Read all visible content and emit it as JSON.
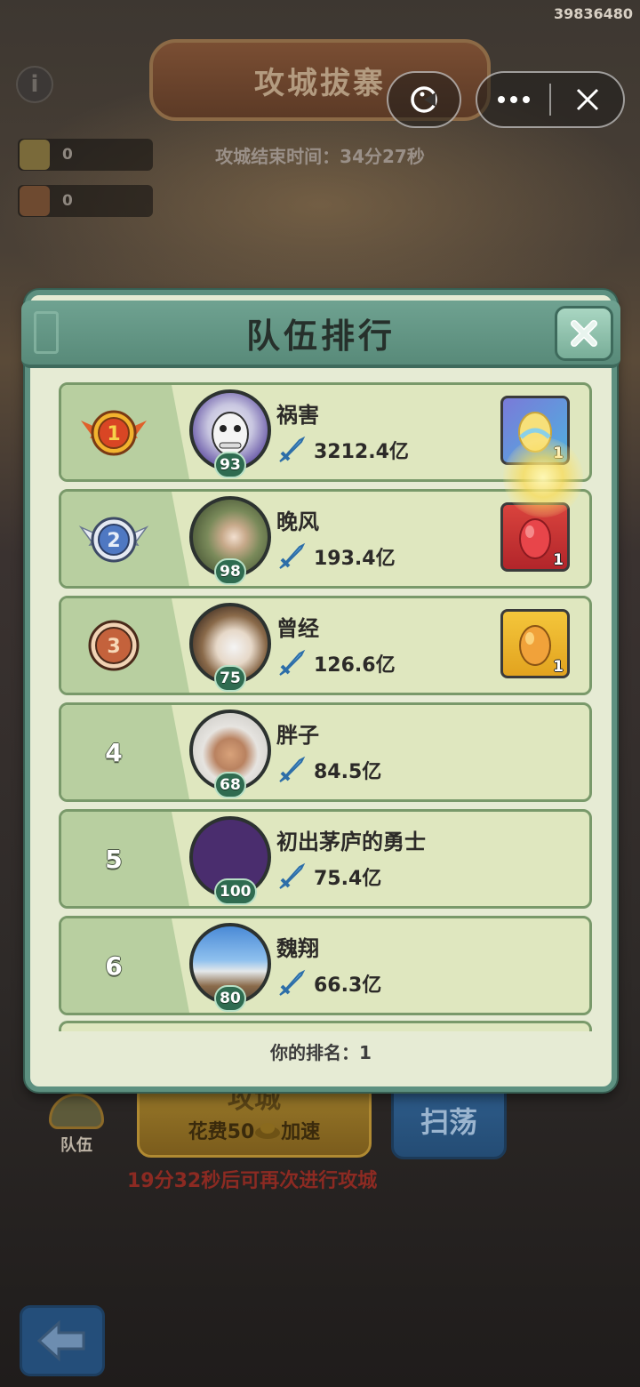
{
  "user_id": "39836480",
  "background": {
    "title": "攻城拔寨",
    "end_time": "攻城结束时间：34分27秒",
    "resources": [
      {
        "icon": "shield-resource-icon",
        "value": "0"
      },
      {
        "icon": "scroll-resource-icon",
        "value": "0"
      }
    ],
    "team_label": "队伍",
    "attack_label": "攻城",
    "attack_cost": "花费50",
    "attack_speed": "加速",
    "sweep_label": "扫荡",
    "cooldown_text": "19分32秒后可再次进行攻城"
  },
  "capsule": {
    "game_icon": "game-icon",
    "more_icon": "more-icon",
    "close_icon": "close-icon"
  },
  "modal": {
    "title": "队伍排行",
    "my_rank": "你的排名：1",
    "rows": [
      {
        "rank": "1",
        "medal": "gold",
        "name": "祸害",
        "level": "93",
        "power": "3212.4亿",
        "reward": {
          "type": "purple",
          "count": "1"
        }
      },
      {
        "rank": "2",
        "medal": "silver",
        "name": "晚风",
        "level": "98",
        "power": "193.4亿",
        "reward": {
          "type": "red",
          "count": "1"
        }
      },
      {
        "rank": "3",
        "medal": "bronze",
        "name": "曾经",
        "level": "75",
        "power": "126.6亿",
        "reward": {
          "type": "gold",
          "count": "1"
        }
      },
      {
        "rank": "4",
        "medal": "",
        "name": "胖子",
        "level": "68",
        "power": "84.5亿"
      },
      {
        "rank": "5",
        "medal": "",
        "name": "初出茅庐的勇士",
        "level": "100",
        "power": "75.4亿"
      },
      {
        "rank": "6",
        "medal": "",
        "name": "魏翔",
        "level": "80",
        "power": "66.3亿"
      }
    ]
  },
  "colors": {
    "modal_border": "#5d9080",
    "row_bg": "#dfe7bf",
    "rank_bg": "#b8cfa0",
    "level_bg": "#2f6b50"
  }
}
